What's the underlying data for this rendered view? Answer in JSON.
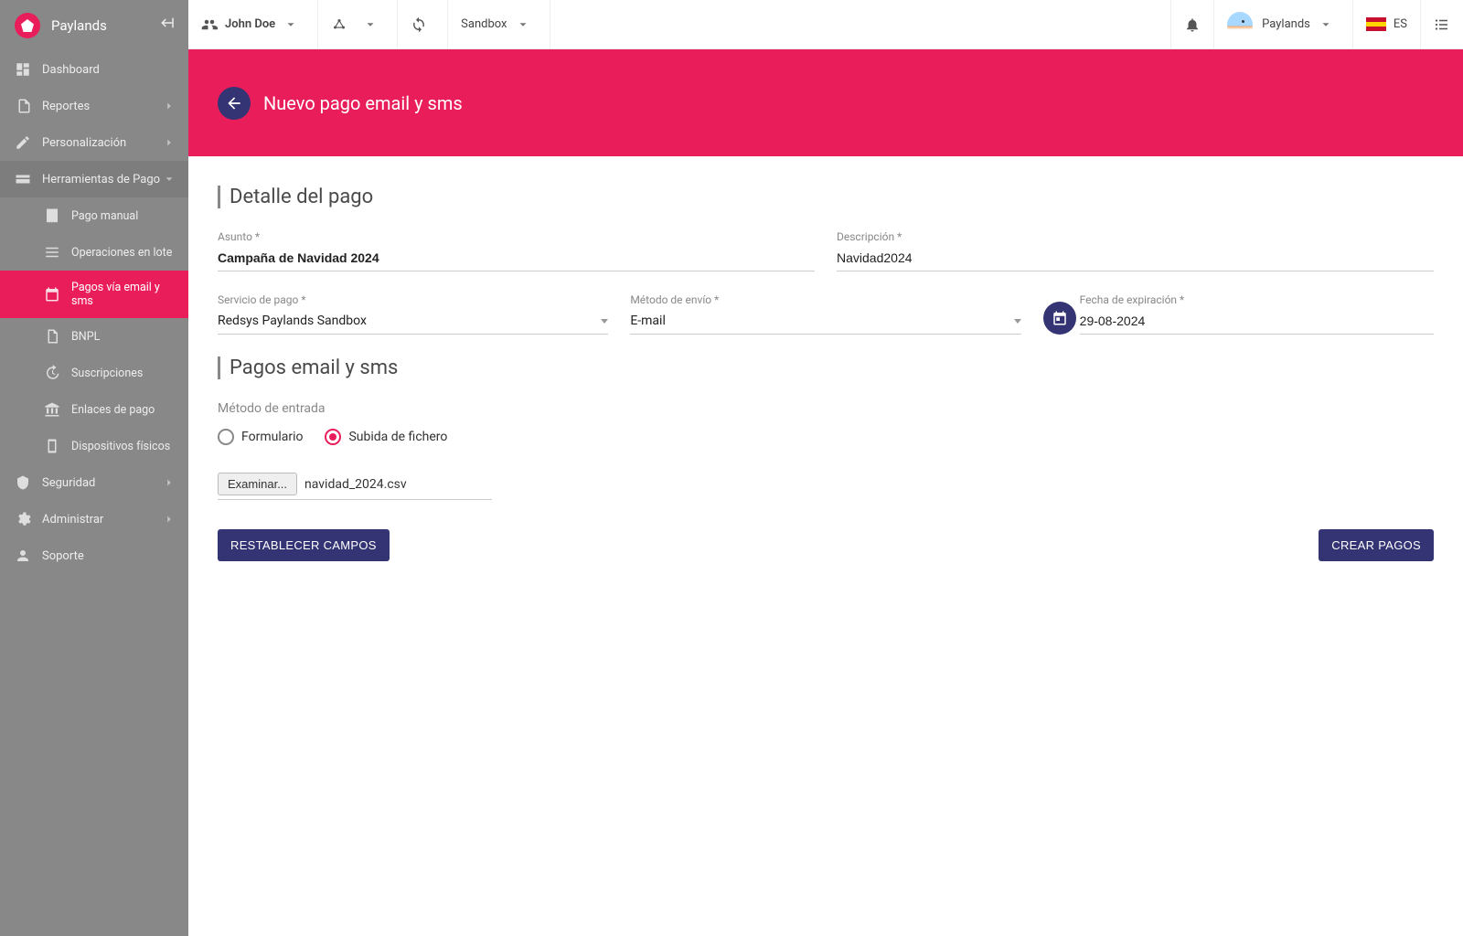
{
  "brand": "Paylands",
  "topbar": {
    "user": "John Doe",
    "env": "Sandbox",
    "account": "Paylands",
    "lang": "ES"
  },
  "sidebar": {
    "items": [
      {
        "label": "Dashboard"
      },
      {
        "label": "Reportes"
      },
      {
        "label": "Personalización"
      },
      {
        "label": "Herramientas de Pago"
      },
      {
        "label": "Seguridad"
      },
      {
        "label": "Administrar"
      },
      {
        "label": "Soporte"
      }
    ],
    "tools_sub": [
      {
        "label": "Pago manual"
      },
      {
        "label": "Operaciones en lote"
      },
      {
        "label": "Pagos vía email y sms"
      },
      {
        "label": "BNPL"
      },
      {
        "label": "Suscripciones"
      },
      {
        "label": "Enlaces de pago"
      },
      {
        "label": "Dispositivos físicos"
      }
    ]
  },
  "page": {
    "title": "Nuevo pago email y sms",
    "section_detail": "Detalle del pago",
    "section_payments": "Pagos email y sms",
    "labels": {
      "asunto": "Asunto *",
      "descripcion": "Descripción *",
      "servicio": "Servicio de pago *",
      "metodo": "Método de envío *",
      "expira": "Fecha de expiración *",
      "input_method": "Método de entrada"
    },
    "values": {
      "asunto": "Campaña de Navidad 2024",
      "descripcion": "Navidad2024",
      "servicio": "Redsys Paylands Sandbox",
      "metodo": "E-mail",
      "expira": "29-08-2024"
    },
    "radio": {
      "formulario": "Formulario",
      "file": "Subida de fichero"
    },
    "file": {
      "browse": "Examinar...",
      "name": "navidad_2024.csv"
    },
    "actions": {
      "reset": "RESTABLECER CAMPOS",
      "create": "CREAR PAGOS"
    }
  }
}
